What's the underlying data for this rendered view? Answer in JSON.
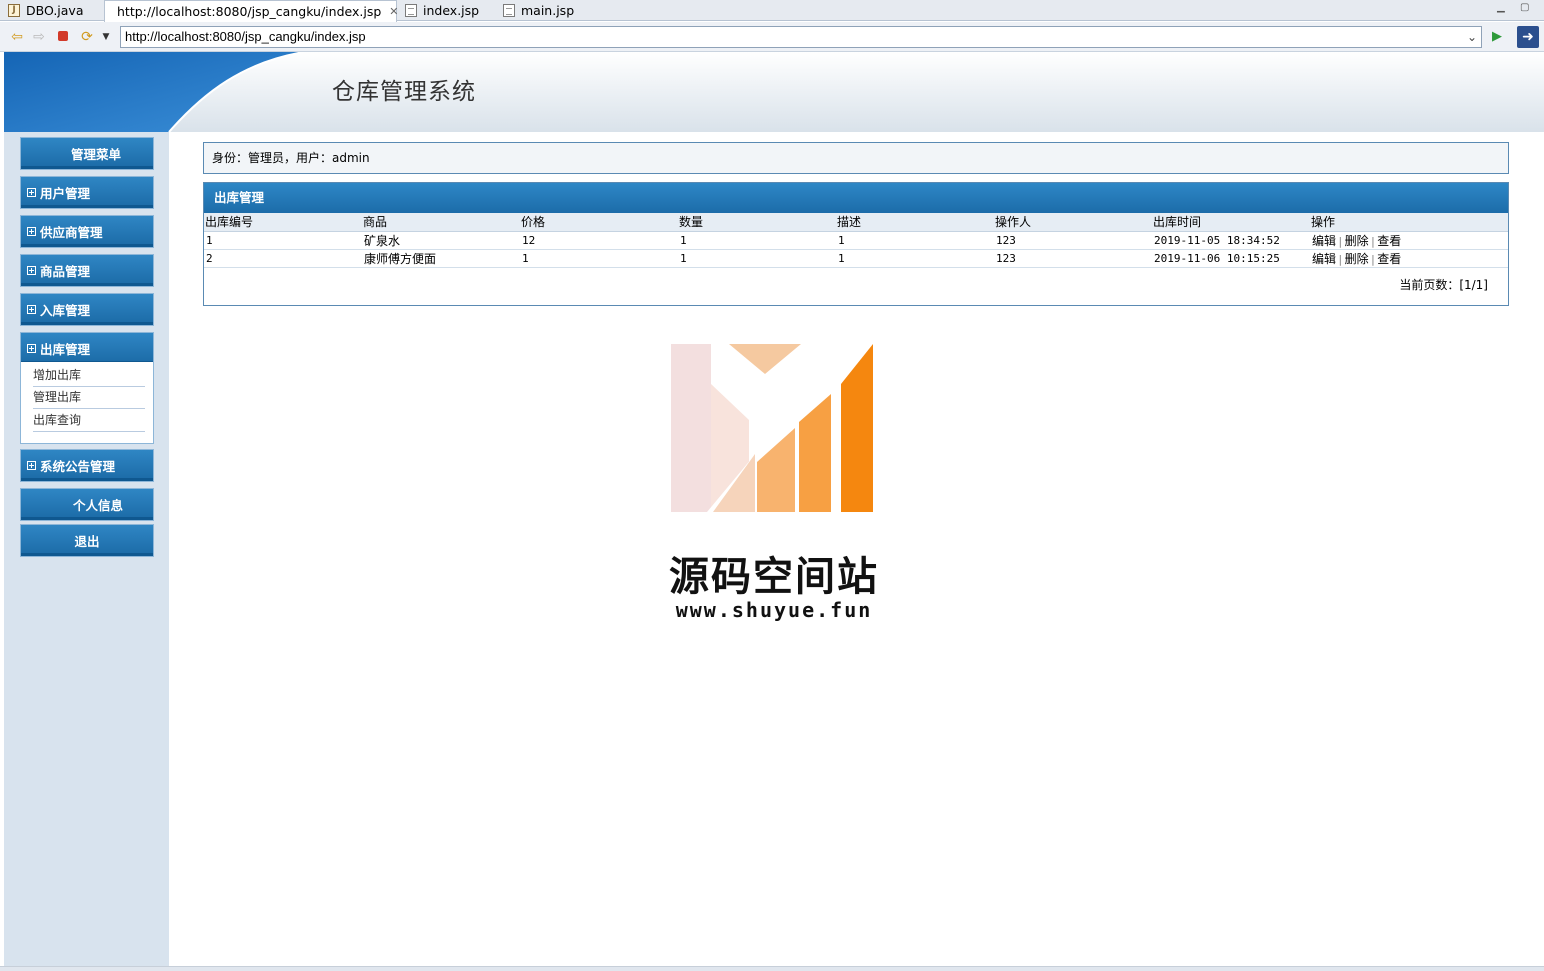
{
  "tabs": [
    {
      "label": "DBO.java",
      "icon": "java-file-icon"
    },
    {
      "label": "http://localhost:8080/jsp_cangku/index.jsp",
      "icon": "globe-icon",
      "active": true
    },
    {
      "label": "index.jsp",
      "icon": "jsp-file-icon"
    },
    {
      "label": "main.jsp",
      "icon": "jsp-file-icon"
    }
  ],
  "address": {
    "url": "http://localhost:8080/jsp_cangku/index.jsp"
  },
  "header": {
    "title": "仓库管理系统"
  },
  "sidebar": {
    "menu_title": "管理菜单",
    "groups": [
      {
        "label": "用户管理"
      },
      {
        "label": "供应商管理"
      },
      {
        "label": "商品管理"
      },
      {
        "label": "入库管理"
      },
      {
        "label": "出库管理",
        "expanded": true
      },
      {
        "label": "系统公告管理"
      }
    ],
    "sub_items": [
      {
        "label": "增加出库"
      },
      {
        "label": "管理出库"
      },
      {
        "label": "出库查询"
      }
    ],
    "personal_info": "个人信息",
    "logout": "退出"
  },
  "identity": {
    "text": "身份：管理员，用户：admin"
  },
  "panel": {
    "title": "出库管理",
    "columns": [
      "出库编号",
      "商品",
      "价格",
      "数量",
      "描述",
      "操作人",
      "出库时间",
      "操作"
    ],
    "rows": [
      {
        "id": "1",
        "product": "矿泉水",
        "price": "12",
        "qty": "1",
        "desc": "1",
        "operator": "123",
        "time": "2019-11-05 18:34:52"
      },
      {
        "id": "2",
        "product": "康师傅方便面",
        "price": "1",
        "qty": "1",
        "desc": "1",
        "operator": "123",
        "time": "2019-11-06 10:15:25"
      }
    ],
    "actions": {
      "edit": "编辑",
      "delete": "删除",
      "view": "查看"
    },
    "pager": "当前页数：[1/1]"
  },
  "watermark": {
    "name": "源码空间站",
    "url": "www.shuyue.fun"
  },
  "colors": {
    "accent": "#1f74b1",
    "sidebar_bg": "#d8e3ee",
    "border": "#5a8ab3",
    "logo_orange": "#f5870f"
  }
}
